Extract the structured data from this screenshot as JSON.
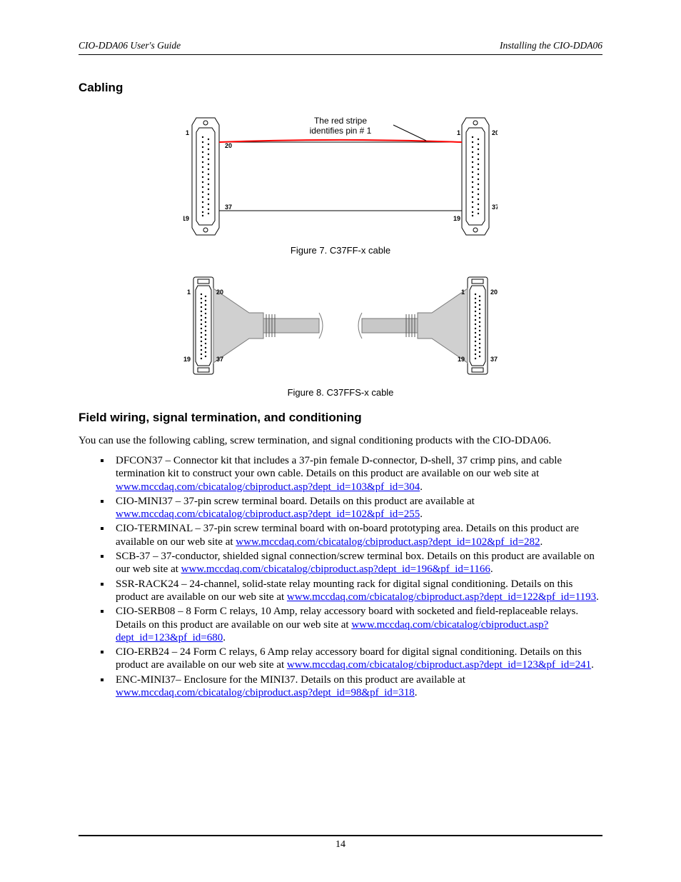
{
  "header": {
    "left": "CIO-DDA06 User's Guide",
    "right": "Installing the CIO-DDA06"
  },
  "sections": {
    "cabling_heading": "Cabling",
    "fieldwiring_heading": "Field wiring, signal termination, and conditioning"
  },
  "figures": {
    "fig7": {
      "callout1": "The red stripe",
      "callout2": "identifies pin # 1",
      "pin1": "1",
      "pin19": "19",
      "pin20": "20",
      "pin37": "37",
      "caption": "Figure 7. C37FF-x cable"
    },
    "fig8": {
      "pin1": "1",
      "pin19": "19",
      "pin20": "20",
      "pin37": "37",
      "caption": "Figure 8. C37FFS-x cable"
    }
  },
  "intro_para": "You can use the following cabling, screw termination, and signal conditioning products with the CIO-DDA06.",
  "items": [
    {
      "text_a": "DFCON37 – Connector kit that includes a 37-pin female D-connector, D-shell, 37 crimp pins, and cable termination kit to construct your own cable. Details on this product are available on our web site at ",
      "link": "www.mccdaq.com/cbicatalog/cbiproduct.asp?dept_id=103&pf_id=304",
      "text_b": "."
    },
    {
      "text_a": "CIO-MINI37 – 37-pin screw terminal board. Details on this product are available at ",
      "link": "www.mccdaq.com/cbicatalog/cbiproduct.asp?dept_id=102&pf_id=255",
      "text_b": "."
    },
    {
      "text_a": "CIO-TERMINAL – 37-pin screw terminal board with on-board prototyping area. Details on this product are available on our web site at ",
      "link": "www.mccdaq.com/cbicatalog/cbiproduct.asp?dept_id=102&pf_id=282",
      "text_b": "."
    },
    {
      "text_a": "SCB-37 – 37-conductor, shielded signal connection/screw terminal box. Details on this product are available on our web site at ",
      "link": "www.mccdaq.com/cbicatalog/cbiproduct.asp?dept_id=196&pf_id=1166",
      "text_b": "."
    },
    {
      "text_a": "SSR-RACK24 – 24-channel, solid-state relay mounting rack for digital signal conditioning. Details on this product are available on our web site at ",
      "link": "www.mccdaq.com/cbicatalog/cbiproduct.asp?dept_id=122&pf_id=1193",
      "text_b": "."
    },
    {
      "text_a": "CIO-SERB08 – 8 Form C relays, 10 Amp, relay accessory board with socketed and field-replaceable relays. Details on this product are available on our web site at ",
      "link": "www.mccdaq.com/cbicatalog/cbiproduct.asp?dept_id=123&pf_id=680",
      "text_b": "."
    },
    {
      "text_a": "CIO-ERB24 – 24 Form C relays, 6 Amp relay accessory board for digital signal conditioning. Details on this product are available on our web site at ",
      "link": "www.mccdaq.com/cbicatalog/cbiproduct.asp?dept_id=123&pf_id=241",
      "text_b": "."
    },
    {
      "text_a": "ENC-MINI37– Enclosure for the MINI37. Details on this product are available at ",
      "link": "www.mccdaq.com/cbicatalog/cbiproduct.asp?dept_id=98&pf_id=318",
      "text_b": "."
    }
  ],
  "footer": {
    "page_number": "14"
  }
}
